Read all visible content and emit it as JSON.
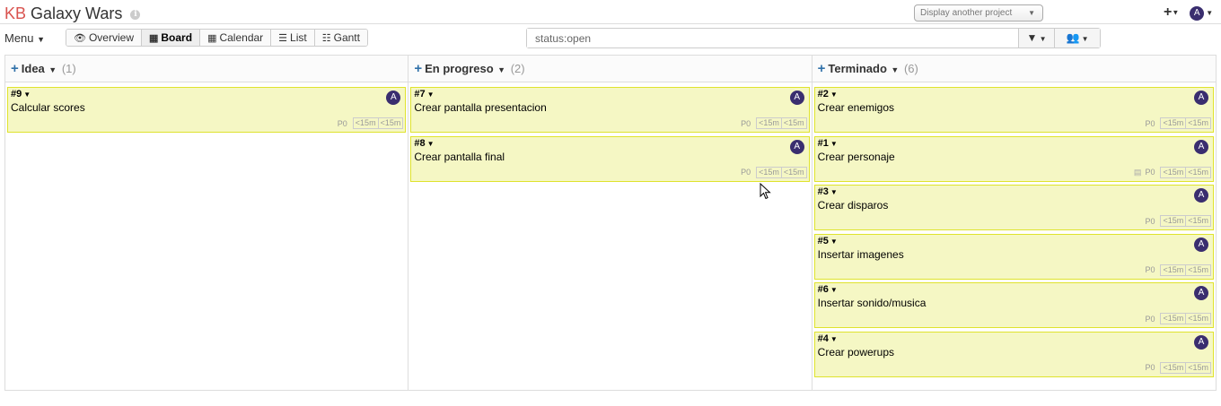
{
  "header": {
    "logo_kb": "KB",
    "project_title": "Galaxy Wars",
    "info_glyph": "i",
    "project_select_label": "Display another project",
    "plus_glyph": "+",
    "user_initial": "A"
  },
  "toolbar": {
    "menu_label": "Menu",
    "views": [
      {
        "icon": "eye-icon",
        "glyph": "👁",
        "label": "Overview"
      },
      {
        "icon": "board-icon",
        "glyph": "▦",
        "label": "Board"
      },
      {
        "icon": "calendar-icon",
        "glyph": "▦",
        "label": "Calendar"
      },
      {
        "icon": "list-icon",
        "glyph": "☰",
        "label": "List"
      },
      {
        "icon": "gantt-icon",
        "glyph": "☷",
        "label": "Gantt"
      }
    ],
    "active_view": "Board",
    "filter_value": "status:open"
  },
  "columns": [
    {
      "name": "Idea",
      "count": "(1)",
      "tasks": [
        {
          "id": "#9",
          "title": "Calcular scores",
          "priority": "P0",
          "est": "<15m",
          "spent": "<15m",
          "assignee": "A",
          "has_doc": false
        }
      ]
    },
    {
      "name": "En progreso",
      "count": "(2)",
      "tasks": [
        {
          "id": "#7",
          "title": "Crear pantalla presentacion",
          "priority": "P0",
          "est": "<15m",
          "spent": "<15m",
          "assignee": "A",
          "has_doc": false
        },
        {
          "id": "#8",
          "title": "Crear pantalla final",
          "priority": "P0",
          "est": "<15m",
          "spent": "<15m",
          "assignee": "A",
          "has_doc": false
        }
      ]
    },
    {
      "name": "Terminado",
      "count": "(6)",
      "tasks": [
        {
          "id": "#2",
          "title": "Crear enemigos",
          "priority": "P0",
          "est": "<15m",
          "spent": "<15m",
          "assignee": "A",
          "has_doc": false
        },
        {
          "id": "#1",
          "title": "Crear personaje",
          "priority": "P0",
          "est": "<15m",
          "spent": "<15m",
          "assignee": "A",
          "has_doc": true
        },
        {
          "id": "#3",
          "title": "Crear disparos",
          "priority": "P0",
          "est": "<15m",
          "spent": "<15m",
          "assignee": "A",
          "has_doc": false
        },
        {
          "id": "#5",
          "title": "Insertar imagenes",
          "priority": "P0",
          "est": "<15m",
          "spent": "<15m",
          "assignee": "A",
          "has_doc": false
        },
        {
          "id": "#6",
          "title": "Insertar sonido/musica",
          "priority": "P0",
          "est": "<15m",
          "spent": "<15m",
          "assignee": "A",
          "has_doc": false
        },
        {
          "id": "#4",
          "title": "Crear powerups",
          "priority": "P0",
          "est": "<15m",
          "spent": "<15m",
          "assignee": "A",
          "has_doc": false
        }
      ]
    }
  ],
  "colors": {
    "card_bg": "#f5f7c4",
    "card_border": "#dfe32d",
    "avatar": "#3a2e6f",
    "add_icon": "#3071a9",
    "logo_kb": "#d9534f"
  }
}
